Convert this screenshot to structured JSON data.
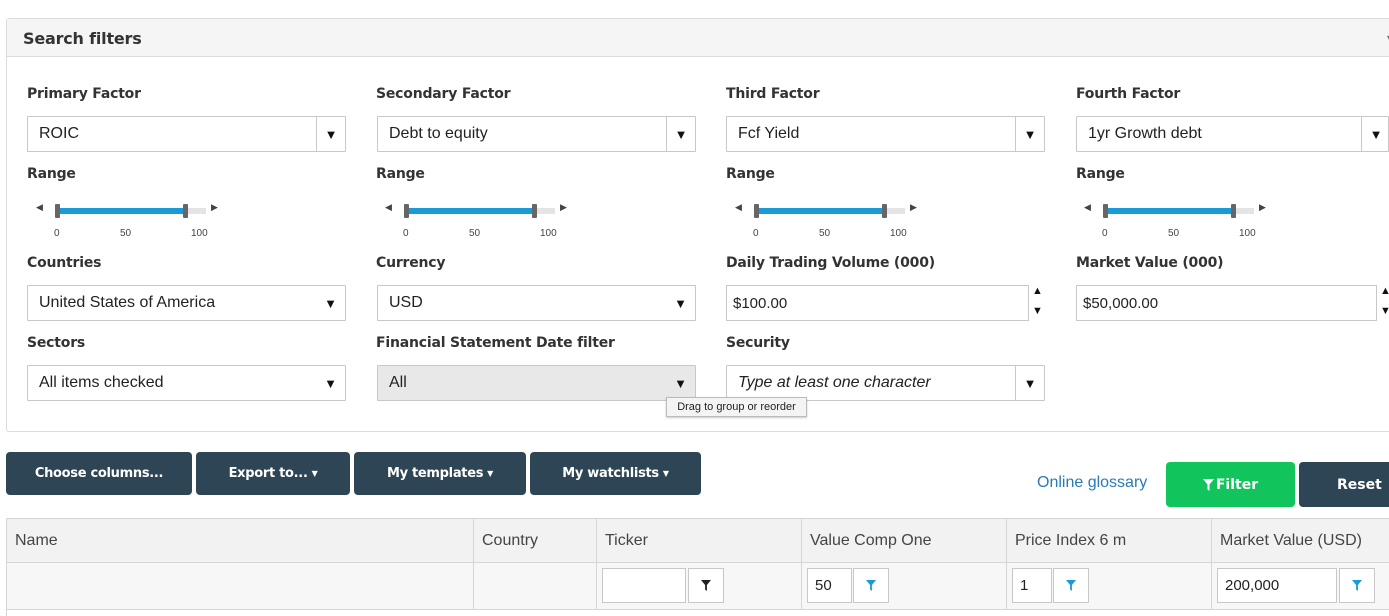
{
  "panel": {
    "title": "Search filters"
  },
  "factors": [
    {
      "label": "Primary Factor",
      "value": "ROIC"
    },
    {
      "label": "Secondary Factor",
      "value": "Debt to equity"
    },
    {
      "label": "Third Factor",
      "value": "Fcf Yield"
    },
    {
      "label": "Fourth Factor",
      "value": "1yr Growth debt"
    }
  ],
  "range": {
    "label": "Range",
    "ticks": [
      "0",
      "50",
      "100"
    ],
    "low_fraction": 0.0,
    "high_fraction": 0.86
  },
  "countries": {
    "label": "Countries",
    "value": "United States of America"
  },
  "currency": {
    "label": "Currency",
    "value": "USD"
  },
  "daily_volume": {
    "label": "Daily Trading Volume (000)",
    "value": "$100.00"
  },
  "market_value": {
    "label": "Market Value (000)",
    "value": "$50,000.00"
  },
  "sectors": {
    "label": "Sectors",
    "value": "All items checked"
  },
  "fin_date": {
    "label": "Financial Statement Date filter",
    "value": "All"
  },
  "security": {
    "label": "Security",
    "placeholder": "Type at least one character"
  },
  "tooltip": "Drag to group or reorder",
  "toolbar": {
    "choose_columns": "Choose columns...",
    "export_to": "Export to...",
    "my_templates": "My templates",
    "my_watchlists": "My watchlists",
    "glossary": "Online glossary",
    "filter": "Filter",
    "reset": "Reset"
  },
  "grid": {
    "columns": [
      "Name",
      "Country",
      "Ticker",
      "Value Comp One",
      "Price Index 6 m",
      "Market Value (USD)"
    ],
    "filters": {
      "ticker": "",
      "value_comp_one": "50",
      "price_index": "1",
      "market_value": "200,000"
    }
  },
  "colors": {
    "accent": "#1a9bd7",
    "dark_button": "#2d4554",
    "filter_green": "#12c45c",
    "link": "#2a7ab8"
  }
}
